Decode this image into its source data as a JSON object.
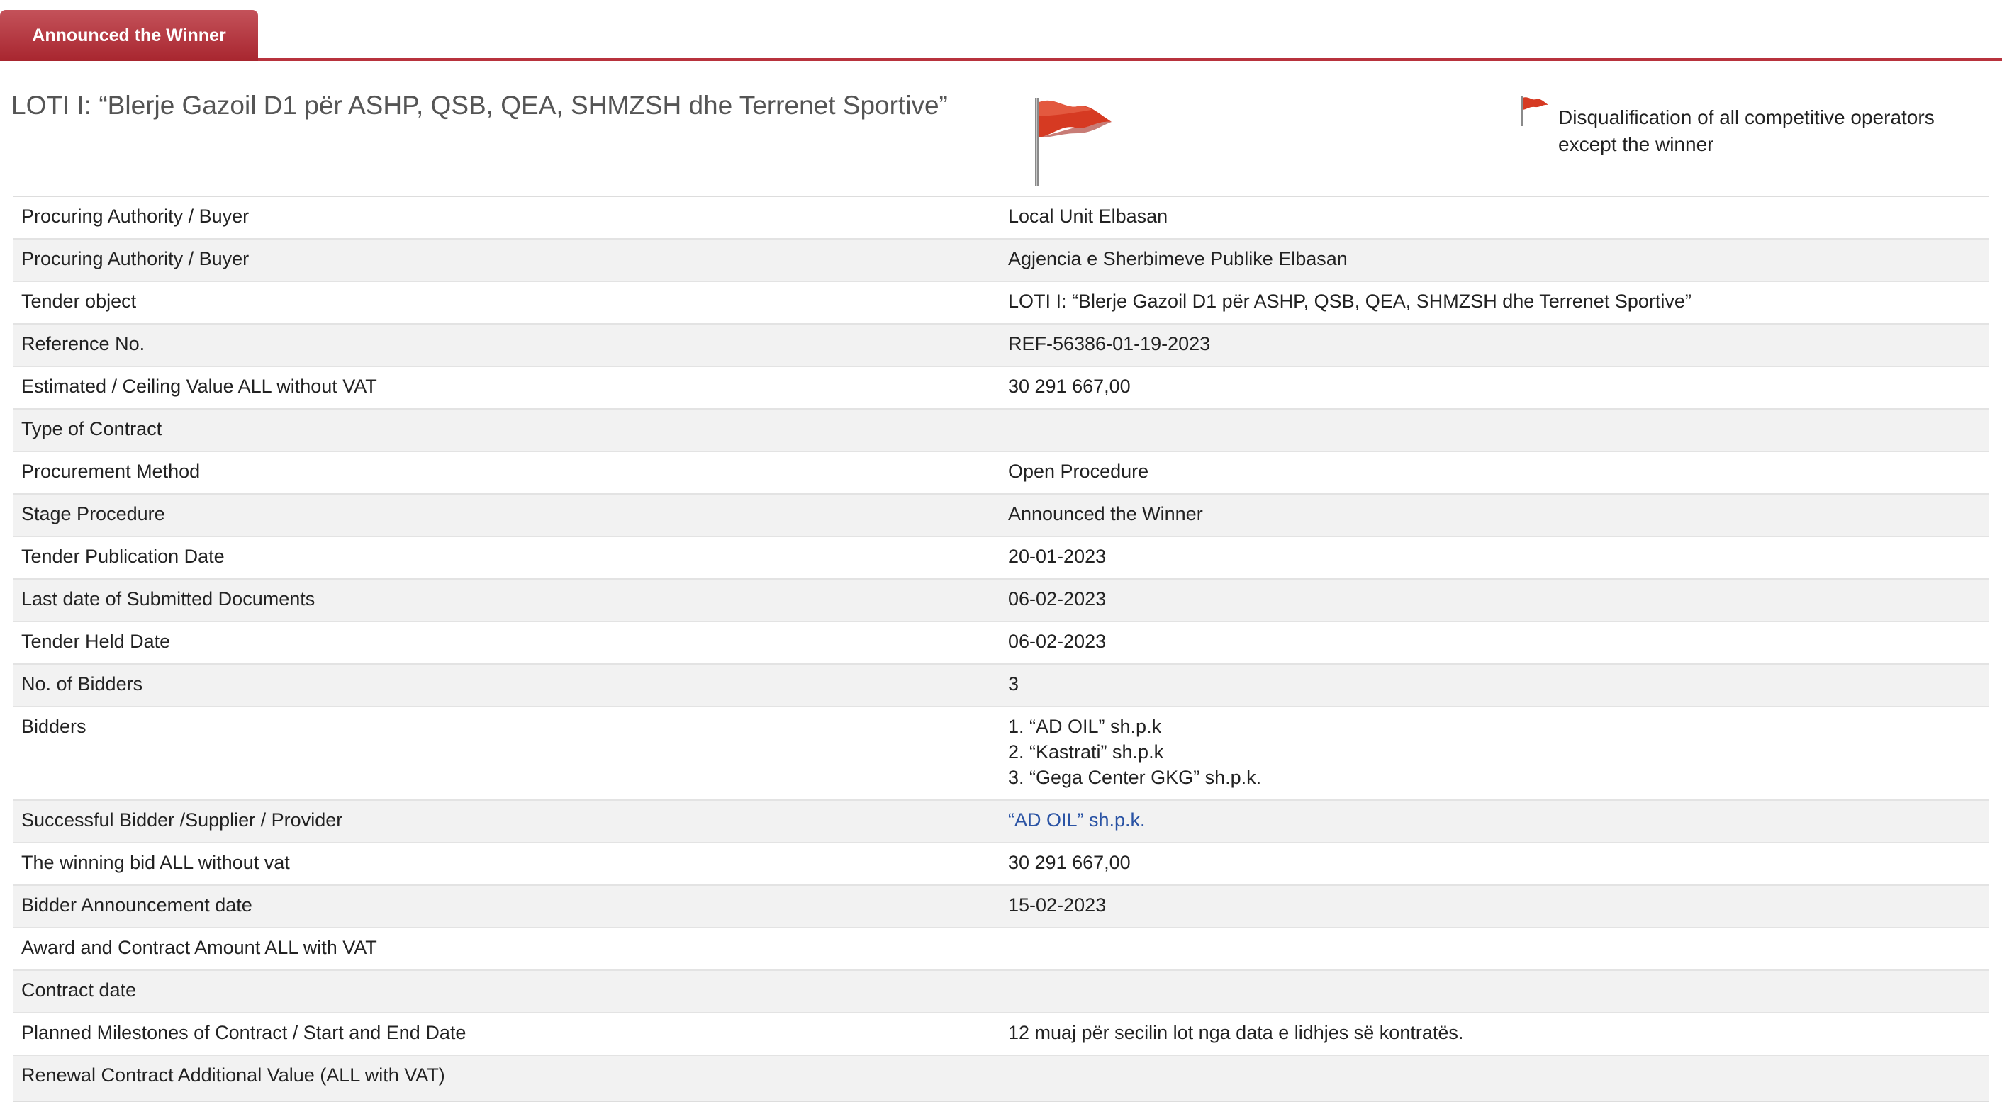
{
  "tab": {
    "label": "Announced the Winner"
  },
  "header": {
    "title": "LOTI I: “Blerje Gazoil D1 për ASHP, QSB, QEA, SHMZSH dhe Terrenet Sportive”",
    "flag_icon": "red-flag-icon",
    "disqualification_note": "Disqualification of all competitive operators except the winner",
    "flag_color": "#d63a22"
  },
  "colors": {
    "accent": "#b8333d",
    "link": "#2a53a4",
    "row_alt": "#f2f2f2"
  },
  "details": {
    "rows": [
      {
        "label": "Procuring Authority / Buyer",
        "value": "Local Unit Elbasan"
      },
      {
        "label": "Procuring Authority / Buyer",
        "value": "Agjencia e Sherbimeve Publike Elbasan"
      },
      {
        "label": "Tender object",
        "value": "LOTI I: “Blerje Gazoil D1 për ASHP, QSB, QEA, SHMZSH dhe Terrenet Sportive”"
      },
      {
        "label": "Reference No.",
        "value": "REF-56386-01-19-2023"
      },
      {
        "label": "Estimated / Ceiling Value ALL without VAT",
        "value": "30 291 667,00"
      },
      {
        "label": "Type of Contract",
        "value": ""
      },
      {
        "label": "Procurement Method",
        "value": "Open Procedure"
      },
      {
        "label": "Stage Procedure",
        "value": "Announced the Winner"
      },
      {
        "label": "Tender Publication Date",
        "value": "20-01-2023"
      },
      {
        "label": "Last date of Submitted Documents",
        "value": "06-02-2023"
      },
      {
        "label": "Tender Held Date",
        "value": "06-02-2023"
      },
      {
        "label": "No. of Bidders",
        "value": "3"
      },
      {
        "label": "Bidders",
        "values": [
          "1. “AD OIL” sh.p.k",
          "2. “Kastrati” sh.p.k",
          "3. “Gega Center GKG” sh.p.k."
        ]
      },
      {
        "label": "Successful Bidder /Supplier / Provider",
        "value": "“AD OIL” sh.p.k."
      },
      {
        "label": "The winning bid ALL without vat",
        "value": "30 291 667,00"
      },
      {
        "label": "Bidder Announcement date",
        "value": "15-02-2023"
      },
      {
        "label": "Award and Contract Amount ALL with VAT",
        "value": ""
      },
      {
        "label": "Contract date",
        "value": ""
      },
      {
        "label": "Planned Milestones of Contract / Start and End Date",
        "value": "12 muaj për secilin lot nga data e lidhjes së kontratës."
      },
      {
        "label": "Renewal Contract Additional Value (ALL with VAT)",
        "value": ""
      }
    ]
  }
}
